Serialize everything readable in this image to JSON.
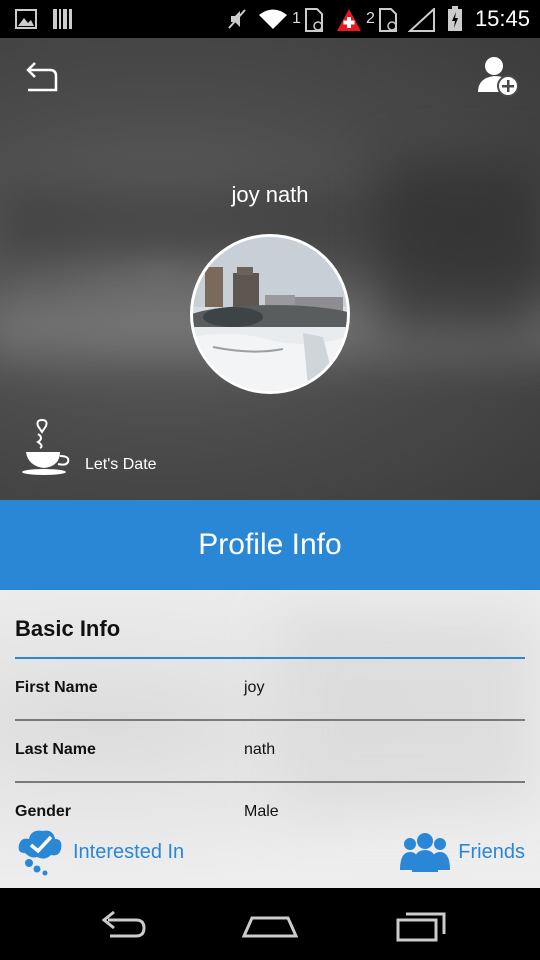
{
  "status_bar": {
    "time": "15:45",
    "sim1": "1",
    "sim2": "2",
    "icons": [
      "image-icon",
      "barcode-icon",
      "mute-icon",
      "wifi-icon",
      "sim-icon",
      "swiss-flag-icon",
      "sim-icon",
      "signal-icon",
      "battery-icon"
    ]
  },
  "header": {
    "name": "joy nath",
    "date_label": "Let's Date",
    "icons": [
      "back-arrow-icon",
      "add-user-icon",
      "coffee-cup-icon"
    ]
  },
  "title_bar": {
    "title": "Profile Info"
  },
  "section": {
    "title": "Basic Info"
  },
  "rows": [
    {
      "label": "First Name",
      "value": "joy"
    },
    {
      "label": "Last Name",
      "value": "nath"
    },
    {
      "label": "Gender",
      "value": "Male"
    }
  ],
  "bottom_tabs": {
    "interested": "Interested In",
    "friends": "Friends"
  },
  "colors": {
    "accent": "#2a87d6",
    "text": "#111111",
    "header": "#4a4a4a"
  }
}
